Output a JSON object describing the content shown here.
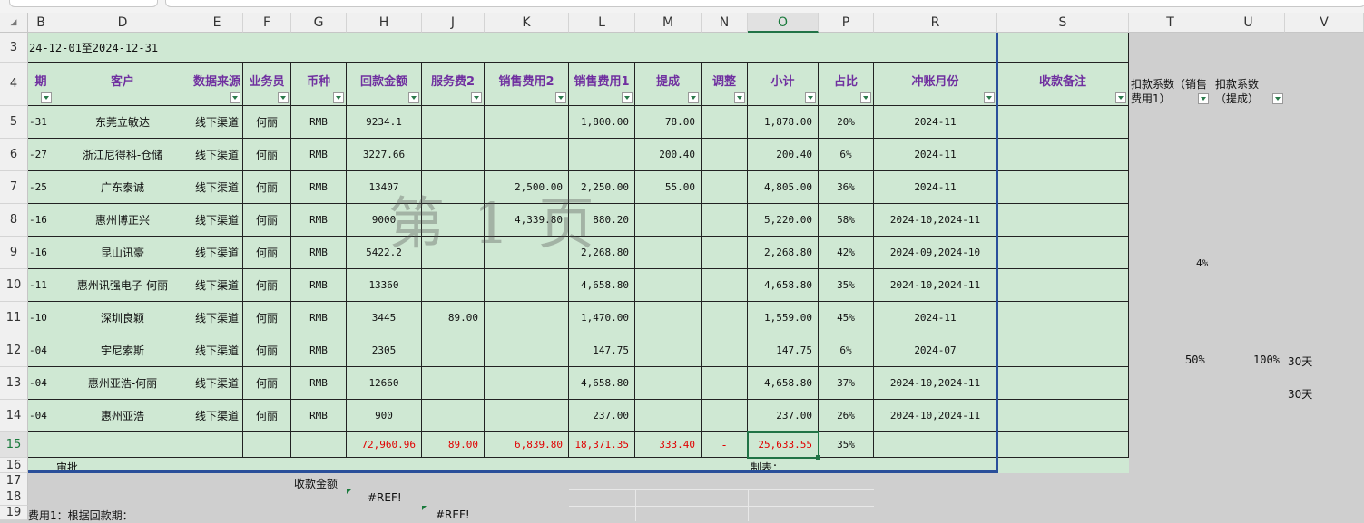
{
  "col_headers": [
    "B",
    "D",
    "E",
    "F",
    "G",
    "H",
    "J",
    "K",
    "L",
    "M",
    "N",
    "O",
    "P",
    "R",
    "S",
    "T",
    "U",
    "V"
  ],
  "row_headers": [
    "3",
    "4",
    "5",
    "6",
    "7",
    "8",
    "9",
    "10",
    "11",
    "12",
    "13",
    "14",
    "15",
    "16",
    "17",
    "18",
    "19"
  ],
  "date_range": "24-12-01至2024-12-31",
  "headers": {
    "date": "期",
    "customer": "客户",
    "source": "数据来源",
    "sales": "业务员",
    "currency": "币种",
    "payment": "回款金额",
    "fee2": "服务费2",
    "sales_fee2": "销售费用2",
    "sales_fee1": "销售费用1",
    "commission": "提成",
    "adjust": "调整",
    "subtotal": "小计",
    "ratio": "占比",
    "month": "冲账月份",
    "remark": "收款备注",
    "coef1": "扣款系数（销售费用1）",
    "coef2": "扣款系数（提成）"
  },
  "rows": [
    {
      "date": "-31",
      "customer": "东莞立敏达",
      "source": "线下渠道",
      "sales": "何丽",
      "currency": "RMB",
      "payment": "9234.1",
      "fee2": "",
      "sales_fee2": "",
      "sales_fee1": "1,800.00",
      "commission": "78.00",
      "adjust": "",
      "subtotal": "1,878.00",
      "ratio": "20%",
      "month": "2024-11"
    },
    {
      "date": "-27",
      "customer": "浙江尼得科-仓储",
      "source": "线下渠道",
      "sales": "何丽",
      "currency": "RMB",
      "payment": "3227.66",
      "fee2": "",
      "sales_fee2": "",
      "sales_fee1": "",
      "commission": "200.40",
      "adjust": "",
      "subtotal": "200.40",
      "ratio": "6%",
      "month": "2024-11"
    },
    {
      "date": "-25",
      "customer": "广东泰诚",
      "source": "线下渠道",
      "sales": "何丽",
      "currency": "RMB",
      "payment": "13407",
      "fee2": "",
      "sales_fee2": "2,500.00",
      "sales_fee1": "2,250.00",
      "commission": "55.00",
      "adjust": "",
      "subtotal": "4,805.00",
      "ratio": "36%",
      "month": "2024-11"
    },
    {
      "date": "-16",
      "customer": "惠州博正兴",
      "source": "线下渠道",
      "sales": "何丽",
      "currency": "RMB",
      "payment": "9000",
      "fee2": "",
      "sales_fee2": "4,339.80",
      "sales_fee1": "880.20",
      "commission": "",
      "adjust": "",
      "subtotal": "5,220.00",
      "ratio": "58%",
      "month": "2024-10,2024-11"
    },
    {
      "date": "-16",
      "customer": "昆山讯豪",
      "source": "线下渠道",
      "sales": "何丽",
      "currency": "RMB",
      "payment": "5422.2",
      "fee2": "",
      "sales_fee2": "",
      "sales_fee1": "2,268.80",
      "commission": "",
      "adjust": "",
      "subtotal": "2,268.80",
      "ratio": "42%",
      "month": "2024-09,2024-10"
    },
    {
      "date": "-11",
      "customer": "惠州讯强电子-何丽",
      "source": "线下渠道",
      "sales": "何丽",
      "currency": "RMB",
      "payment": "13360",
      "fee2": "",
      "sales_fee2": "",
      "sales_fee1": "4,658.80",
      "commission": "",
      "adjust": "",
      "subtotal": "4,658.80",
      "ratio": "35%",
      "month": "2024-10,2024-11"
    },
    {
      "date": "-10",
      "customer": "深圳良颖",
      "source": "线下渠道",
      "sales": "何丽",
      "currency": "RMB",
      "payment": "3445",
      "fee2": "89.00",
      "sales_fee2": "",
      "sales_fee1": "1,470.00",
      "commission": "",
      "adjust": "",
      "subtotal": "1,559.00",
      "ratio": "45%",
      "month": "2024-11"
    },
    {
      "date": "-04",
      "customer": "宇尼索斯",
      "source": "线下渠道",
      "sales": "何丽",
      "currency": "RMB",
      "payment": "2305",
      "fee2": "",
      "sales_fee2": "",
      "sales_fee1": "147.75",
      "commission": "",
      "adjust": "",
      "subtotal": "147.75",
      "ratio": "6%",
      "month": "2024-07"
    },
    {
      "date": "-04",
      "customer": "惠州亚浩-何丽",
      "source": "线下渠道",
      "sales": "何丽",
      "currency": "RMB",
      "payment": "12660",
      "fee2": "",
      "sales_fee2": "",
      "sales_fee1": "4,658.80",
      "commission": "",
      "adjust": "",
      "subtotal": "4,658.80",
      "ratio": "37%",
      "month": "2024-10,2024-11"
    },
    {
      "date": "-04",
      "customer": "惠州亚浩",
      "source": "线下渠道",
      "sales": "何丽",
      "currency": "RMB",
      "payment": "900",
      "fee2": "",
      "sales_fee2": "",
      "sales_fee1": "237.00",
      "commission": "",
      "adjust": "",
      "subtotal": "237.00",
      "ratio": "26%",
      "month": "2024-10,2024-11"
    }
  ],
  "totals": {
    "payment": "72,960.96",
    "fee2": "89.00",
    "sales_fee2": "6,839.80",
    "sales_fee1": "18,371.35",
    "commission": "333.40",
    "adjust": "-",
    "subtotal": "25,633.55",
    "ratio": "35%"
  },
  "row16": {
    "approve": "审批",
    "maker": "制表："
  },
  "row17": {
    "label": "收款金额"
  },
  "row18": {
    "ref": "#REF!"
  },
  "row19": {
    "label": "费用1：根据回款期：",
    "ref": "#REF!"
  },
  "side": {
    "t9": "4%",
    "t12": "50%",
    "u12": "100%",
    "v12": "30天",
    "v13": "30天"
  },
  "watermark": "第 1 页",
  "colors": {
    "header_text": "#7030a0",
    "green_fill": "#cfe8d3",
    "negative_red": "#e00000",
    "selection": "#217346"
  }
}
